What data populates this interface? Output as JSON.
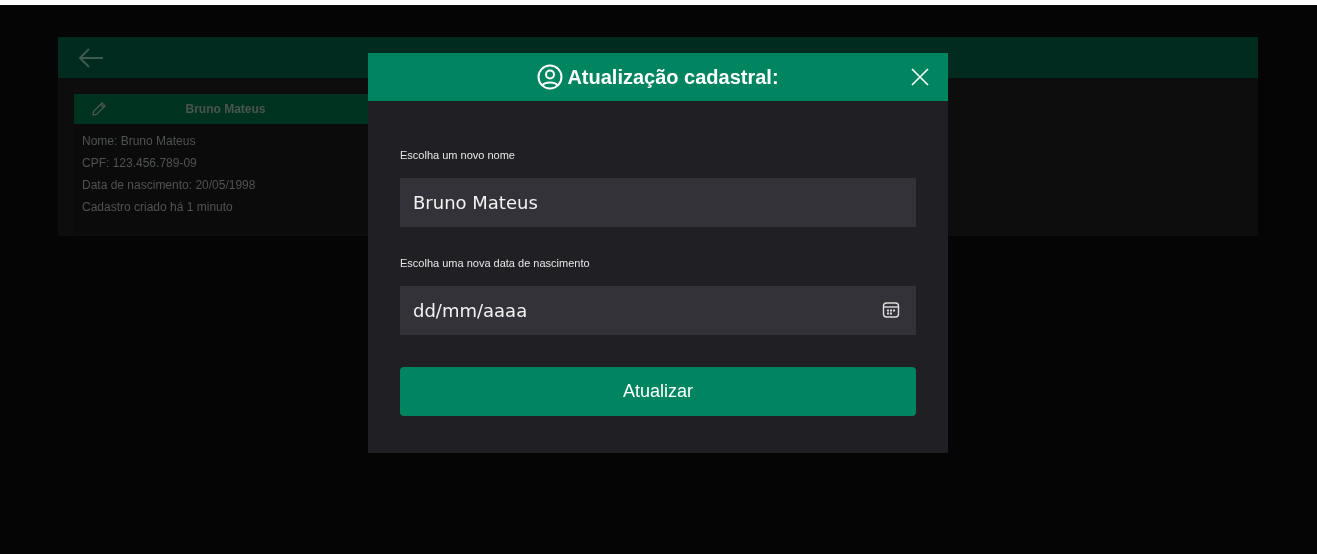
{
  "page": {
    "client_card": {
      "title": "Bruno Mateus",
      "details": [
        "Nome: Bruno Mateus",
        "CPF: 123.456.789-09",
        "Data de nascimento: 20/05/1998",
        "Cadastro criado há 1 minuto"
      ]
    }
  },
  "modal": {
    "title": "Atualização cadastral:",
    "fields": [
      {
        "kind": "text",
        "label": "Escolha um novo nome",
        "value": "Bruno Mateus"
      },
      {
        "kind": "date",
        "label": "Escolha uma nova data de nascimento",
        "placeholder": "dd/mm/aaaa"
      }
    ],
    "submit": "Atualizar"
  }
}
